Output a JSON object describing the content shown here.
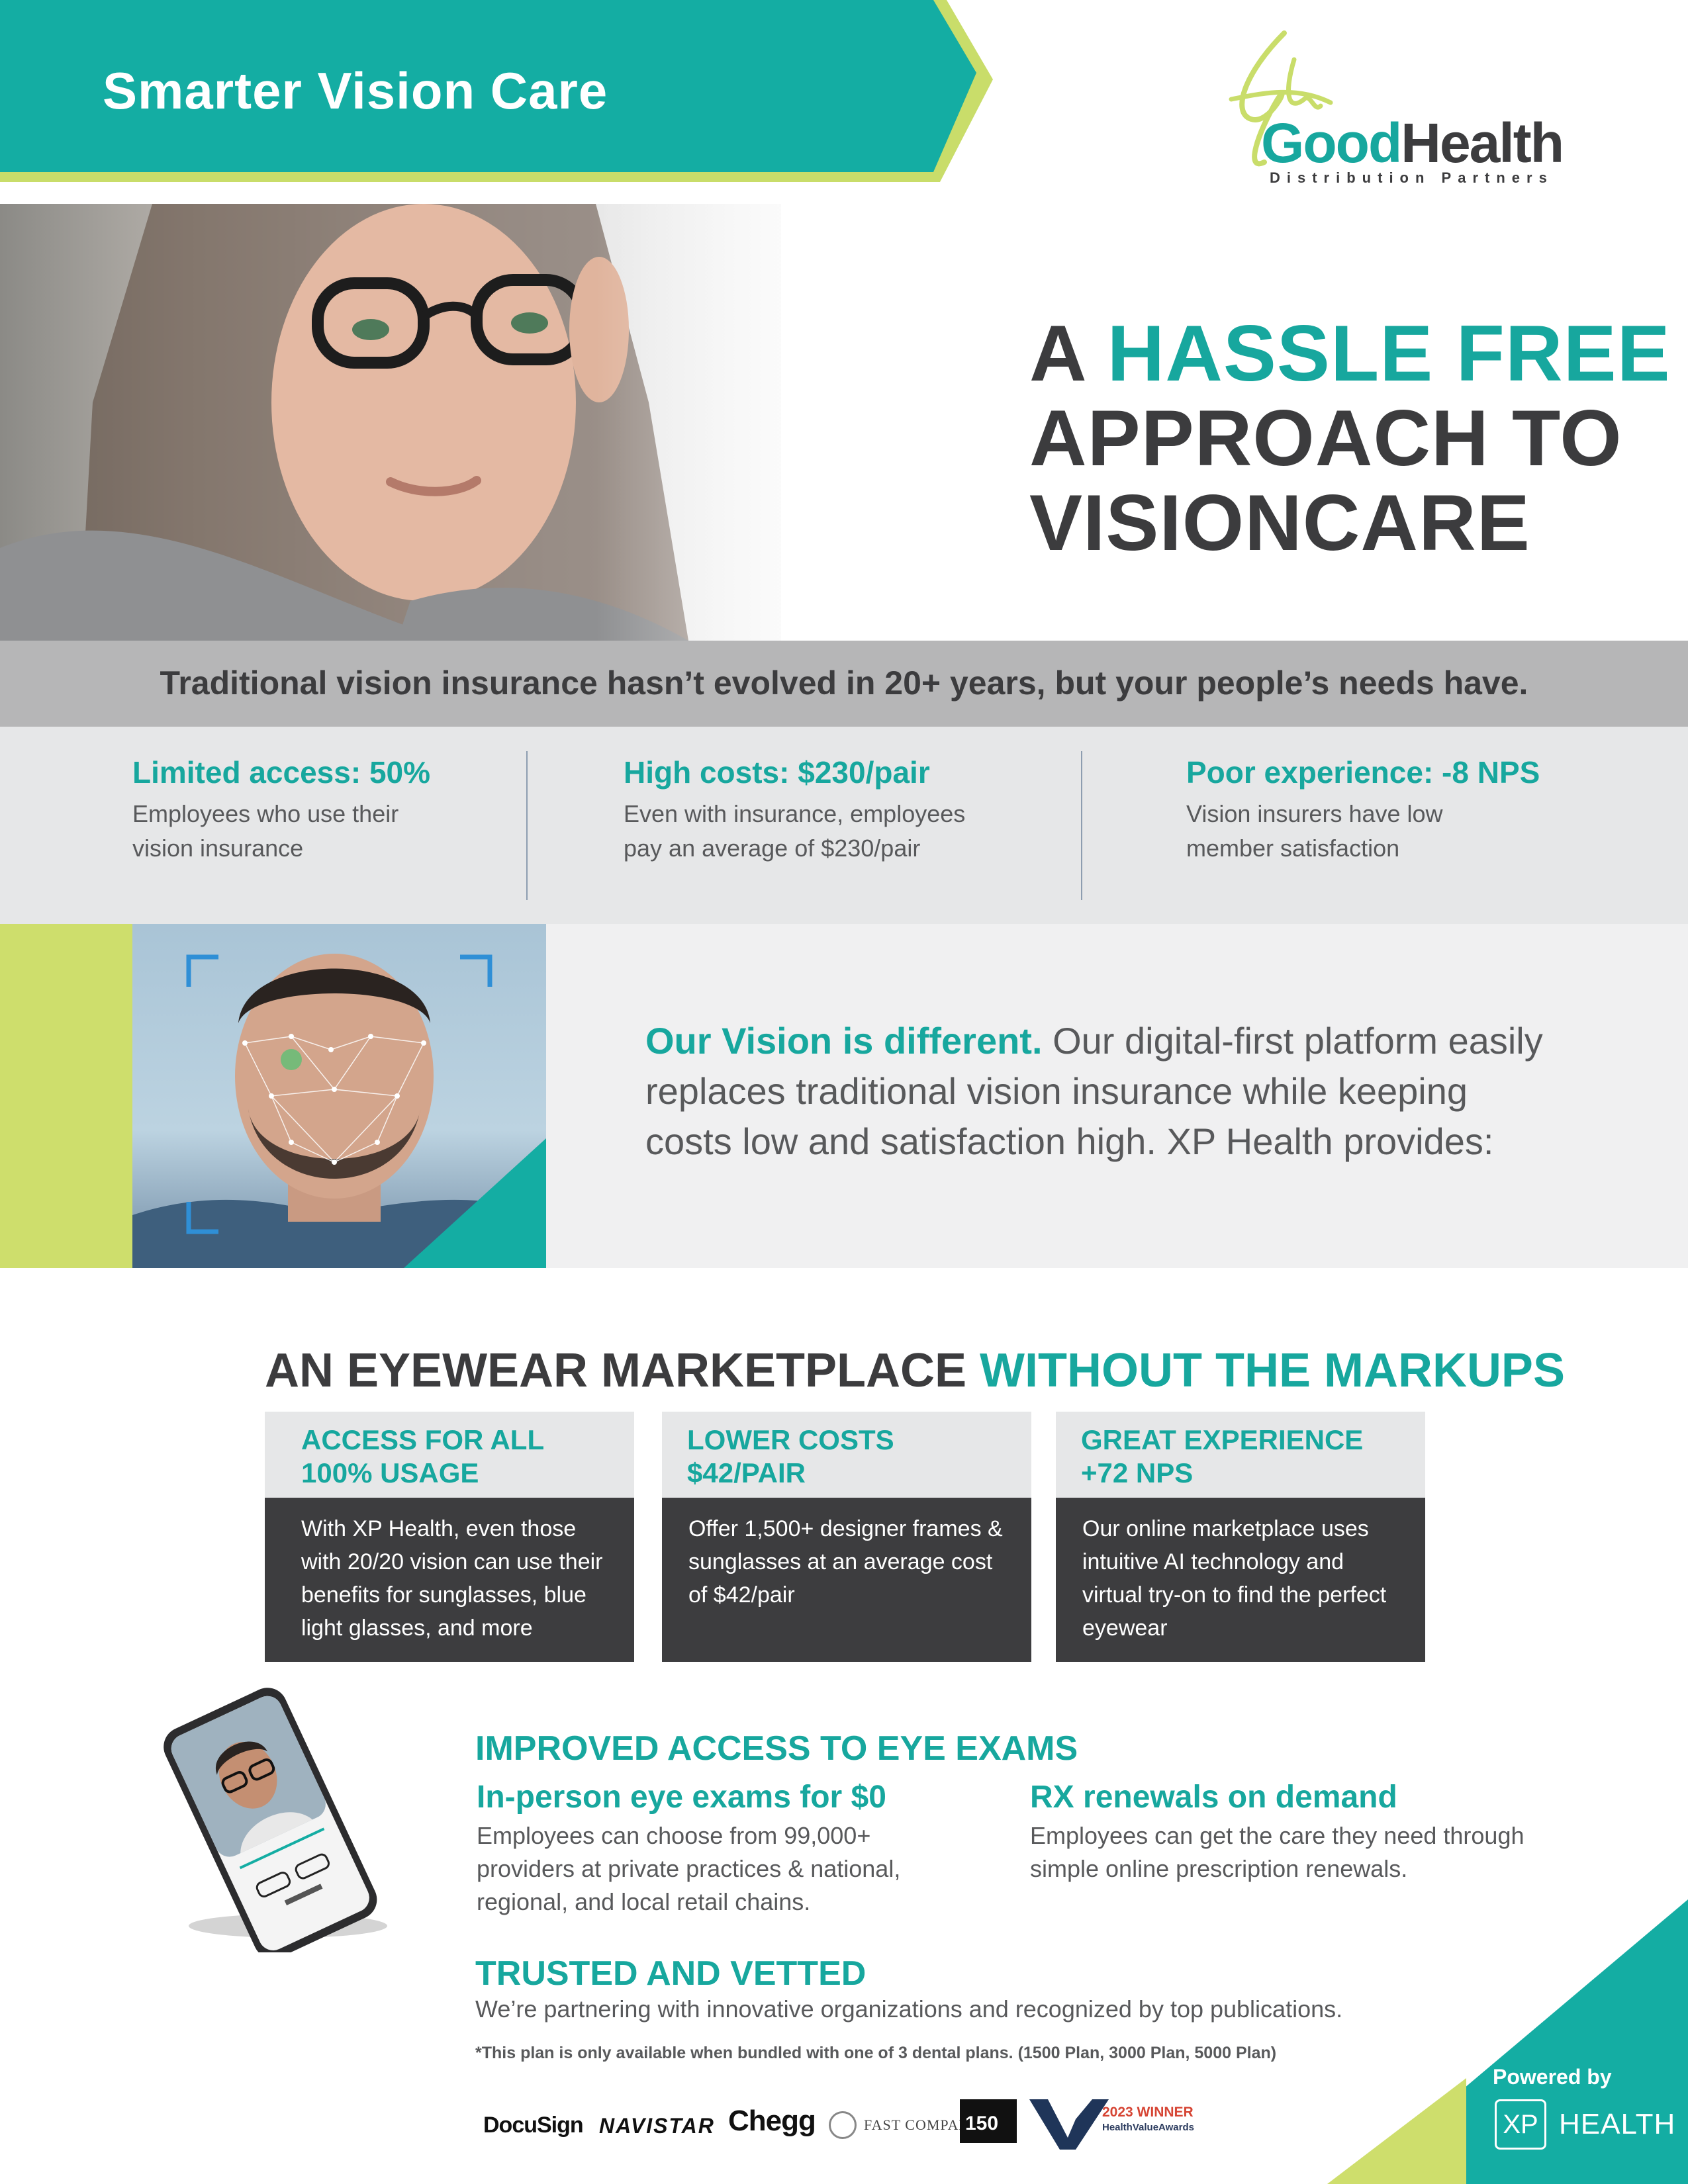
{
  "banner": {
    "title": "Smarter Vision Care"
  },
  "logo": {
    "good": "Good",
    "health": "Health",
    "subtitle": "Distribution Partners"
  },
  "hero": {
    "line1_a": "A ",
    "line1_b": "HASSLE FREE",
    "line2": "APPROACH TO",
    "line3": "VISIONCARE"
  },
  "band": {
    "text": "Traditional vision insurance hasn’t evolved in 20+ years, but your people’s needs have."
  },
  "stats": [
    {
      "title": "Limited access: 50%",
      "body1": "Employees who use their",
      "body2": "vision insurance"
    },
    {
      "title": "High costs: $230/pair",
      "body1": "Even with insurance, employees",
      "body2": "pay an average of $230/pair"
    },
    {
      "title": "Poor experience: -8 NPS",
      "body1": "Vision insurers have low",
      "body2": "member satisfaction"
    }
  ],
  "vision": {
    "lead": "Our Vision is different.",
    "body": " Our digital-first platform easily replaces traditional vision insurance while keeping costs low and satisfaction high. XP Health provides:"
  },
  "marketplace": {
    "heading_a": "AN EYEWEAR MARKETPLACE ",
    "heading_b": "WITHOUT THE MARKUPS",
    "cards": [
      {
        "head1": "ACCESS FOR ALL",
        "head2": "100% USAGE",
        "body": "With XP Health, even those with 20/20 vision can use their benefits for sunglasses, blue light glasses, and more"
      },
      {
        "head1": "LOWER COSTS",
        "head2": "$42/PAIR",
        "body": "Offer 1,500+ designer frames & sunglasses at an average cost of $42/pair"
      },
      {
        "head1": "GREAT EXPERIENCE",
        "head2": "+72 NPS",
        "body": "Our online marketplace uses intuitive AI technology and virtual try-on to find the perfect eyewear"
      }
    ]
  },
  "exams": {
    "heading": "IMPROVED ACCESS TO EYE EXAMS",
    "items": [
      {
        "title": "In-person eye exams for $0",
        "body": "Employees can choose from 99,000+ providers at private practices & national, regional, and local retail chains."
      },
      {
        "title": "RX renewals on demand",
        "body": "Employees can get the care they need through simple online prescription renewals."
      }
    ]
  },
  "trusted": {
    "heading": "TRUSTED AND VETTED",
    "body": "We’re partnering with innovative organizations and recognized by top publications.",
    "disclaimer": "*This plan is only available when bundled with one of 3 dental plans. (1500 Plan, 3000 Plan, 5000 Plan)"
  },
  "brands": {
    "docusign": "DocuSign",
    "navistar": "NAVISTAR",
    "chegg": "Chegg",
    "fastco": "FAST COMPANY",
    "num150": "150",
    "award_year": "2023 WINNER",
    "award_name": "HealthValueAwards"
  },
  "powered": {
    "label": "Powered by",
    "xp": "XP",
    "health": "HEALTH"
  },
  "colors": {
    "teal": "#17a79e",
    "lime": "#cede6c",
    "dark": "#3c3c3e",
    "gray_band": "#b6b6b7"
  }
}
